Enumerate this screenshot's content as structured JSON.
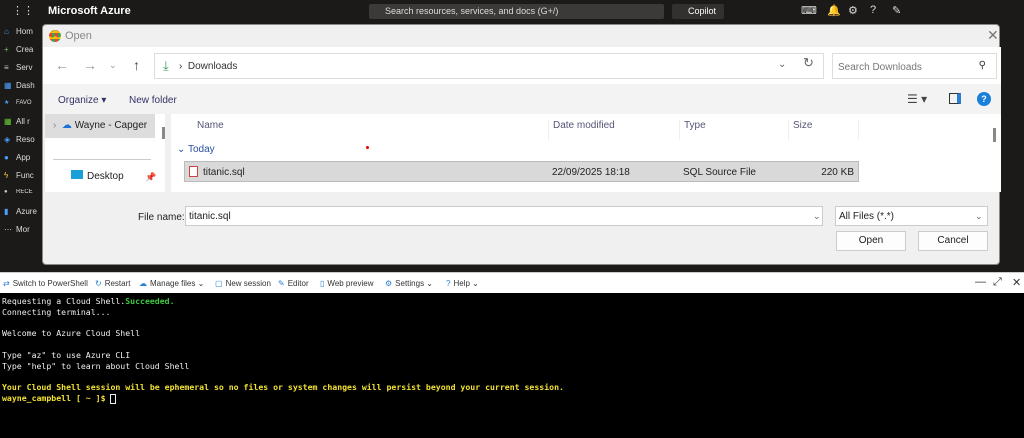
{
  "topbar": {
    "brand": "Microsoft Azure",
    "search_placeholder": "Search resources, services, and docs (G+/)",
    "copilot": "Copilot"
  },
  "sidebar": {
    "items": [
      "Hom",
      "Crea",
      "Serv",
      "Dash",
      "FAVO",
      "All r",
      "Reso",
      "App",
      "Func",
      "RECE",
      "Azure",
      "Mor"
    ]
  },
  "dialog": {
    "title": "Open",
    "address": "Downloads",
    "search_placeholder": "Search Downloads",
    "organize": "Organize",
    "new_folder": "New folder",
    "nav": {
      "onedrive": "Wayne - Capger",
      "desktop": "Desktop"
    },
    "columns": [
      "Name",
      "Date modified",
      "Type",
      "Size"
    ],
    "group": "Today",
    "files": [
      {
        "name": "titanic.sql",
        "date": "22/09/2025 18:18",
        "type": "SQL Source File",
        "size": "220 KB"
      }
    ],
    "file_name_label": "File name:",
    "file_name": "titanic.sql",
    "filter": "All Files (*.*)",
    "open": "Open",
    "cancel": "Cancel"
  },
  "shell": {
    "toolbar": [
      "Switch to PowerShell",
      "Restart",
      "Manage files",
      "New session",
      "Editor",
      "Web preview",
      "Settings",
      "Help"
    ],
    "lines": {
      "l1a": "Requesting a Cloud Shell.",
      "l1b": "Succeeded.",
      "l2": "Connecting terminal...",
      "l3": "Welcome to Azure Cloud Shell",
      "l4": "Type \"az\" to use Azure CLI",
      "l5": "Type \"help\" to learn about Cloud Shell",
      "l6": "Your Cloud Shell session will be ephemeral so no files or system changes will persist beyond your current session.",
      "prompt": "wayne_campbell [ ~ ]$ "
    }
  },
  "colors": {
    "accent": "#1a7fd8",
    "success": "#3ec83e",
    "warning": "#f2e233"
  }
}
